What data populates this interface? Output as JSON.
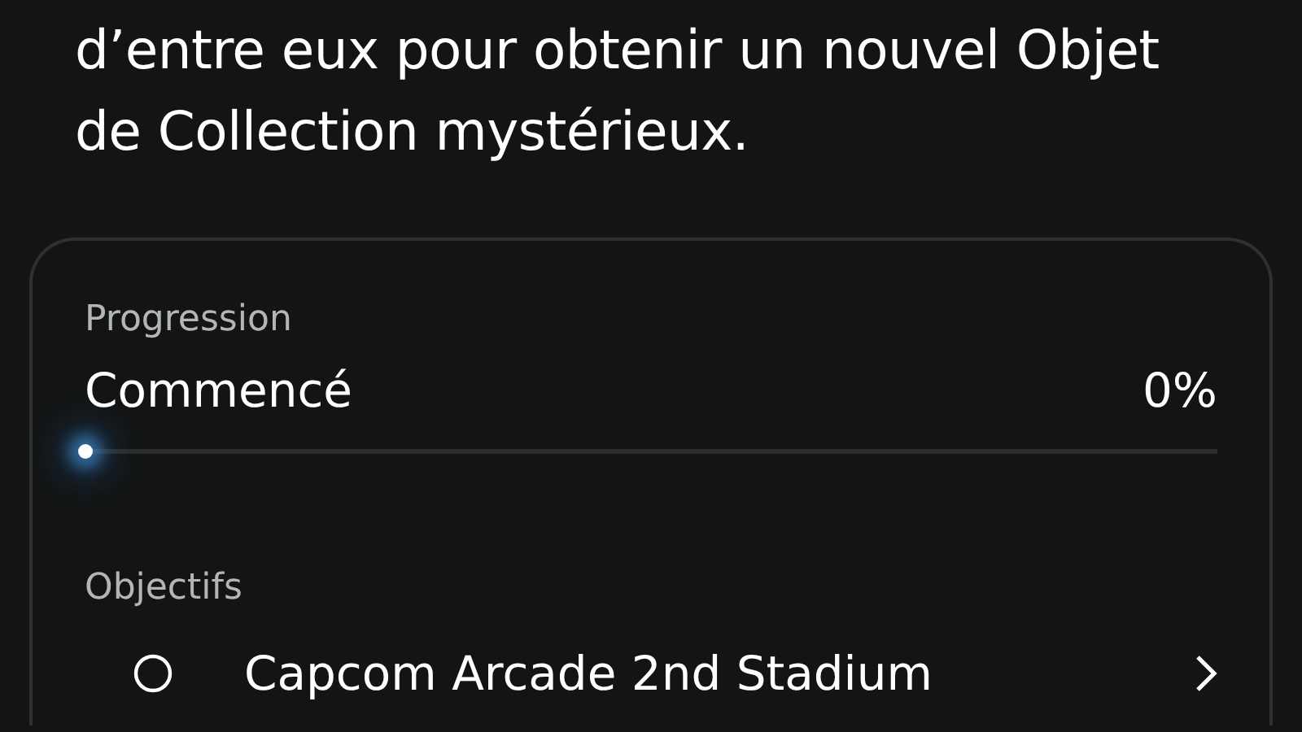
{
  "description": "d’entre eux pour obtenir un nouvel Objet de Collection mystérieux.",
  "progress": {
    "label": "Progression",
    "status": "Commencé",
    "percent": "0%",
    "level": 0
  },
  "objectives": {
    "label": "Objectifs",
    "items": [
      {
        "title": "Capcom Arcade 2nd Stadium",
        "completed": false
      }
    ]
  }
}
